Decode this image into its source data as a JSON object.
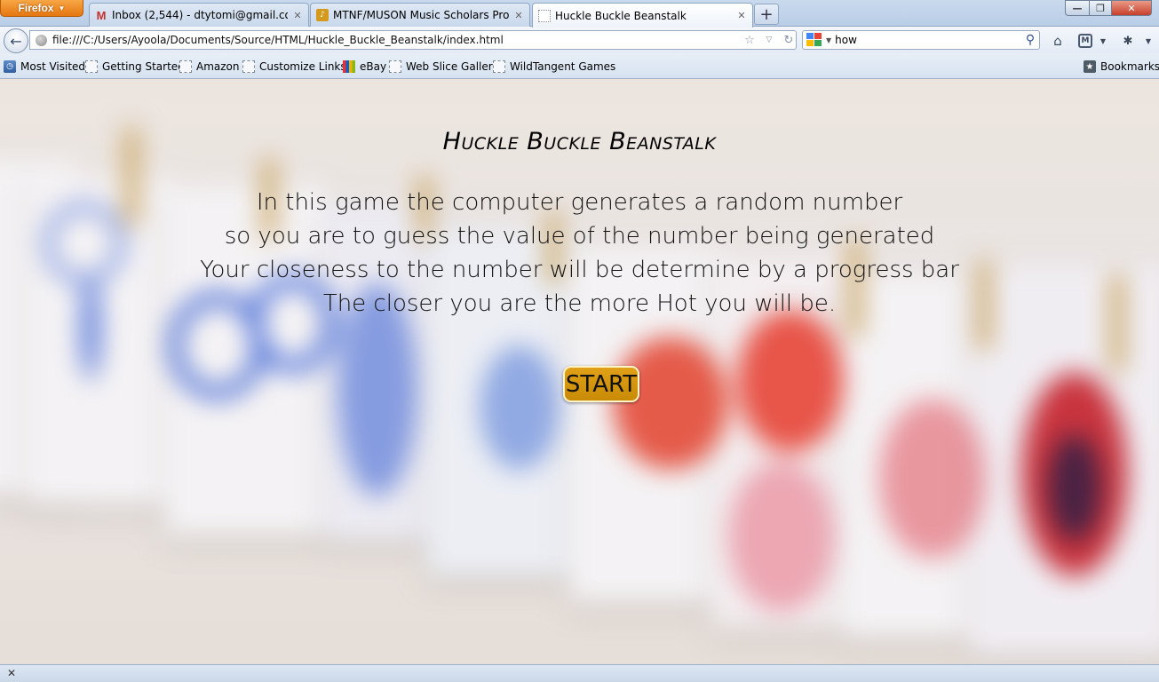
{
  "browser": {
    "menu_button": "Firefox",
    "tabs": [
      {
        "label": "Inbox (2,544) - dtytomi@gmail.com -...",
        "favicon": "gmail-icon"
      },
      {
        "label": "MTNF/MUSON Music Scholars Progr...",
        "favicon": "mtnf-icon"
      },
      {
        "label": "Huckle Buckle Beanstalk",
        "favicon": "blank-page-icon",
        "active": true
      }
    ],
    "url": "file:///C:/Users/Ayoola/Documents/Source/HTML/Huckle_Buckle_Beanstalk/index.html",
    "search_value": "how",
    "bookmarks": [
      {
        "label": "Most Visited"
      },
      {
        "label": "Getting Started"
      },
      {
        "label": "Amazon"
      },
      {
        "label": "Customize Links"
      },
      {
        "label": "eBay"
      },
      {
        "label": "Web Slice Gallery"
      },
      {
        "label": "WildTangent Games"
      }
    ],
    "bookmarks_menu": "Bookmarks"
  },
  "game": {
    "title": "Huckle Buckle Beanstalk",
    "intro_lines": [
      "In this game the computer generates a random number",
      "so you are to guess the value of the number being generated",
      "Your closeness to the number will be determine by a progress bar",
      "The closer you are the more Hot you will be."
    ],
    "start_label": "START",
    "start_color": "#d69a10"
  }
}
